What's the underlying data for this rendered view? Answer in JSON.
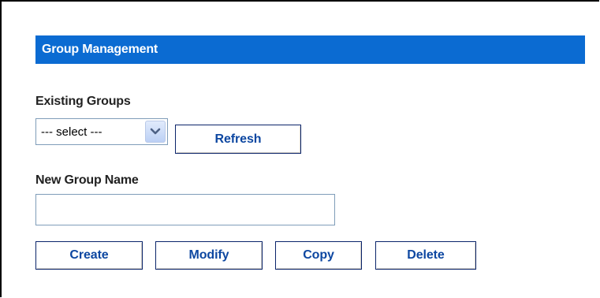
{
  "section": {
    "title": "Group Management",
    "header_color": "#0b6bd2"
  },
  "existing_groups": {
    "label": "Existing Groups",
    "selected_value": "--- select ---",
    "arrow_icon": "chevron-down-icon"
  },
  "refresh_button": {
    "label": "Refresh"
  },
  "new_group": {
    "label": "New Group Name",
    "value": "",
    "placeholder": ""
  },
  "actions": {
    "create_label": "Create",
    "modify_label": "Modify",
    "copy_label": "Copy",
    "delete_label": "Delete"
  },
  "colors": {
    "button_text": "#0d47a1",
    "button_border": "#0a246a"
  }
}
